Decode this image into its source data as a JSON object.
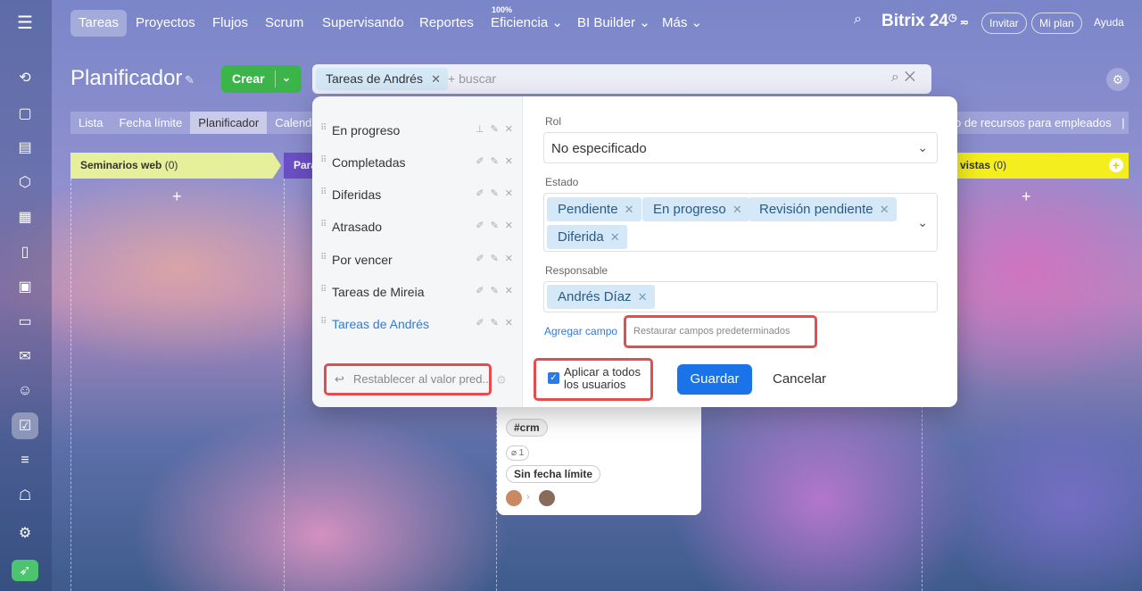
{
  "topbar": {
    "nav": [
      {
        "label": "Tareas",
        "active": true
      },
      {
        "label": "Proyectos"
      },
      {
        "label": "Flujos"
      },
      {
        "label": "Scrum"
      },
      {
        "label": "Supervisando"
      },
      {
        "label": "Reportes"
      },
      {
        "label": "Eficiencia ⌄",
        "badge": "100%"
      },
      {
        "label": "BI Builder ⌄"
      },
      {
        "label": "Más ⌄"
      }
    ],
    "logo": "Bitrix 24",
    "invite": "Invitar",
    "my_plan": "Mi plan",
    "help": "Ayuda"
  },
  "page": {
    "title": "Planificador",
    "create_label": "Crear"
  },
  "search": {
    "chip": "Tareas de Andrés",
    "placeholder": "+ buscar"
  },
  "view_tabs": [
    "Lista",
    "Fecha límite",
    "Planificador",
    "Calenda"
  ],
  "right_select": "o de recursos para empleados",
  "columns": [
    {
      "name": "Seminarios web",
      "count": "(0)",
      "color": "#e6ef9a"
    },
    {
      "name": "Para",
      "color": "#6b4fc8"
    },
    {
      "name": "vistas",
      "count": "(0)",
      "color": "#f5ee1e"
    }
  ],
  "card": {
    "tag": "#crm",
    "attachments": "⌀ 1",
    "deadline": "Sin fecha límite"
  },
  "dialog": {
    "presets": [
      {
        "label": "En progreso",
        "pinned": true
      },
      {
        "label": "Completadas"
      },
      {
        "label": "Diferidas"
      },
      {
        "label": "Atrasado"
      },
      {
        "label": "Por vencer"
      },
      {
        "label": "Tareas de Mireia"
      },
      {
        "label": "Tareas de Andrés",
        "selected": true
      }
    ],
    "reset_label": "Restablecer al valor pred...",
    "rol_label": "Rol",
    "rol_value": "No especificado",
    "estado_label": "Estado",
    "estado_chips": [
      "Pendiente",
      "En progreso",
      "Revisión pendiente",
      "Diferida"
    ],
    "responsable_label": "Responsable",
    "responsable_chip": "Andrés Díaz",
    "add_field": "Agregar campo",
    "restore_fields": "Restaurar campos predeterminados",
    "apply_all": "Aplicar a todos los usuarios",
    "save": "Guardar",
    "cancel": "Cancelar"
  }
}
